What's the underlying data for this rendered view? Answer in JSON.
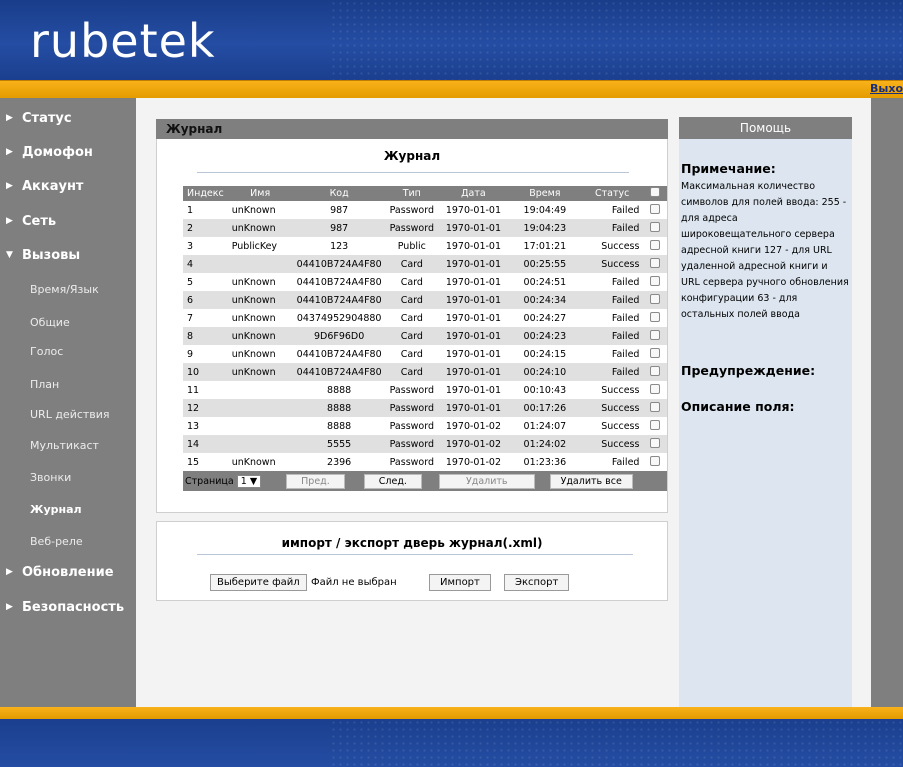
{
  "header": {
    "logo": "rubetek",
    "logout": "Выхо"
  },
  "sidebar": {
    "items": [
      {
        "label": "Статус",
        "expanded": false
      },
      {
        "label": "Домофон",
        "expanded": false
      },
      {
        "label": "Аккаунт",
        "expanded": false
      },
      {
        "label": "Сеть",
        "expanded": false
      },
      {
        "label": "Вызовы",
        "expanded": true
      },
      {
        "label": "Обновление",
        "expanded": false
      },
      {
        "label": "Безопасность",
        "expanded": false
      }
    ],
    "subitems": [
      "Время/Язык",
      "Общие",
      "Голос",
      "План",
      "URL действия",
      "Мультикаст",
      "Звонки",
      "Журнал",
      "Веб-реле"
    ],
    "active_subitem": "Журнал"
  },
  "panel": {
    "header": "Журнал",
    "title": "Журнал",
    "columns": [
      "Индекс",
      "Имя",
      "Код",
      "Тип",
      "Дата",
      "Время",
      "Статус"
    ],
    "rows": [
      [
        "1",
        "unKnown",
        "987",
        "Password",
        "1970-01-01",
        "19:04:49",
        "Failed"
      ],
      [
        "2",
        "unKnown",
        "987",
        "Password",
        "1970-01-01",
        "19:04:23",
        "Failed"
      ],
      [
        "3",
        "PublicKey",
        "123",
        "Public",
        "1970-01-01",
        "17:01:21",
        "Success"
      ],
      [
        "4",
        "",
        "04410B724A4F80",
        "Card",
        "1970-01-01",
        "00:25:55",
        "Success"
      ],
      [
        "5",
        "unKnown",
        "04410B724A4F80",
        "Card",
        "1970-01-01",
        "00:24:51",
        "Failed"
      ],
      [
        "6",
        "unKnown",
        "04410B724A4F80",
        "Card",
        "1970-01-01",
        "00:24:34",
        "Failed"
      ],
      [
        "7",
        "unKnown",
        "04374952904880",
        "Card",
        "1970-01-01",
        "00:24:27",
        "Failed"
      ],
      [
        "8",
        "unKnown",
        "9D6F96D0",
        "Card",
        "1970-01-01",
        "00:24:23",
        "Failed"
      ],
      [
        "9",
        "unKnown",
        "04410B724A4F80",
        "Card",
        "1970-01-01",
        "00:24:15",
        "Failed"
      ],
      [
        "10",
        "unKnown",
        "04410B724A4F80",
        "Card",
        "1970-01-01",
        "00:24:10",
        "Failed"
      ],
      [
        "11",
        "",
        "8888",
        "Password",
        "1970-01-01",
        "00:10:43",
        "Success"
      ],
      [
        "12",
        "",
        "8888",
        "Password",
        "1970-01-01",
        "00:17:26",
        "Success"
      ],
      [
        "13",
        "",
        "8888",
        "Password",
        "1970-01-02",
        "01:24:07",
        "Success"
      ],
      [
        "14",
        "",
        "5555",
        "Password",
        "1970-01-02",
        "01:24:02",
        "Success"
      ],
      [
        "15",
        "unKnown",
        "2396",
        "Password",
        "1970-01-02",
        "01:23:36",
        "Failed"
      ]
    ],
    "pager": {
      "page_label": "Страница",
      "page_value": "1",
      "prev": "Пред.",
      "next": "След.",
      "delete": "Удалить",
      "delete_all": "Удалить все"
    }
  },
  "import_export": {
    "title": "импорт / экспорт дверь журнал(.xml)",
    "choose_file": "Выберите файл",
    "no_file": "Файл не выбран",
    "import": "Импорт",
    "export": "Экспорт"
  },
  "help": {
    "header": "Помощь",
    "note_title": "Примечание:",
    "note_text": "Максимальная количество символов для полей ввода: 255 - для адреса широковещательного сервера адресной книги 127 - для URL удаленной адресной книги и URL сервера ручного обновления конфигурации 63 - для остальных полей ввода",
    "warning_title": "Предупреждение:",
    "field_title": "Описание поля:"
  }
}
